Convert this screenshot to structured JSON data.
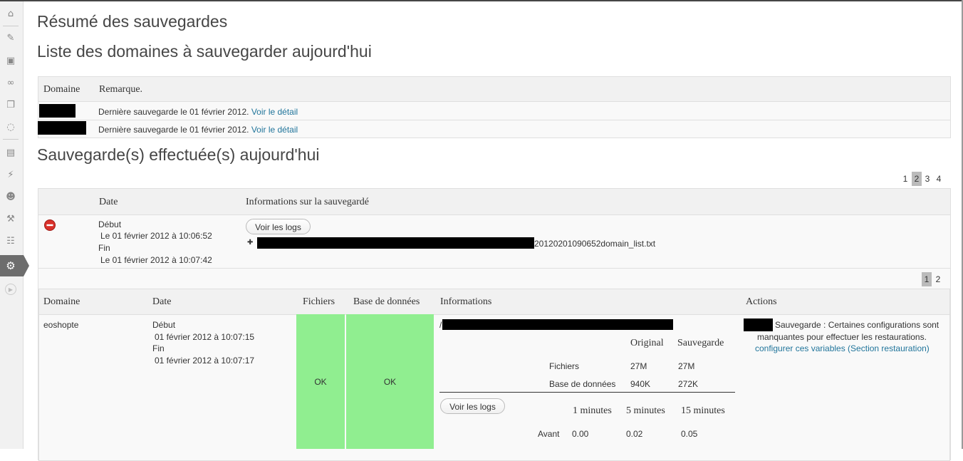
{
  "titles": {
    "summary": "Résumé des sauvegardes",
    "domains_today": "Liste des domaines à sauvegarder aujourd'hui",
    "backups_today": "Sauvegarde(s) effectuée(s) aujourd'hui"
  },
  "domains_table": {
    "headers": [
      "Domaine",
      "Remarque."
    ],
    "rows": [
      {
        "remark": "Dernière sauvegarde le 01 février 2012.",
        "link": "Voir le détail"
      },
      {
        "remark": "Dernière sauvegarde le 01 février 2012.",
        "link": "Voir le détail"
      }
    ]
  },
  "pager_top": {
    "pages": [
      "1",
      "2",
      "3",
      "4"
    ],
    "current": "2"
  },
  "backups_table": {
    "headers": [
      "Date",
      "Informations sur la sauvegardé"
    ],
    "row": {
      "start_label": "Début",
      "start_value": "Le 01 février 2012 à 10:06:52",
      "end_label": "Fin",
      "end_value": "Le 01 février 2012 à 10:07:42",
      "logs_button": "Voir les logs",
      "plus": "✚",
      "file_suffix": "20120201090652domain_list.txt"
    }
  },
  "pager_inner": {
    "pages": [
      "1",
      "2"
    ],
    "current": "1"
  },
  "detail_table": {
    "headers": [
      "Domaine",
      "Date",
      "Fichiers",
      "Base de données",
      "Informations",
      "Actions"
    ],
    "row": {
      "domain": "eoshopte",
      "start_label": "Début",
      "start_value": "01 février 2012 à 10:07:15",
      "end_label": "Fin",
      "end_value": "01 février 2012 à 10:07:17",
      "files_status": "OK",
      "db_status": "OK",
      "path_prefix": "/",
      "size_headers": [
        "Original",
        "Sauvegarde"
      ],
      "size_rows": [
        {
          "label": "Fichiers",
          "original": "27M",
          "backup": "27M"
        },
        {
          "label": "Base de données",
          "original": "940K",
          "backup": "272K"
        }
      ],
      "logs_button": "Voir les logs",
      "load_headers": [
        "1 minutes",
        "5 minutes",
        "15 minutes"
      ],
      "load_rows": [
        {
          "label": "Avant",
          "values": [
            "0.00",
            "0.02",
            "0.05"
          ]
        }
      ],
      "action_text_1": "Sauvegarde : Certaines configurations sont",
      "action_text_2": "manquantes pour effectuer les restaurations.",
      "action_link": "configurer ces variables (Section restauration)"
    }
  },
  "colors": {
    "ok": "#90ee90",
    "link": "#21759b",
    "active_menu": "#6d6d6d"
  },
  "sidebar": {
    "icons": [
      "dashboard-icon",
      "posts-pin-icon",
      "media-icon",
      "links-icon",
      "pages-icon",
      "comments-icon",
      "appearance-icon",
      "plugins-icon",
      "users-icon",
      "tools-icon",
      "settings-icon",
      "backup-gear-icon",
      "collapse-play-icon"
    ]
  }
}
